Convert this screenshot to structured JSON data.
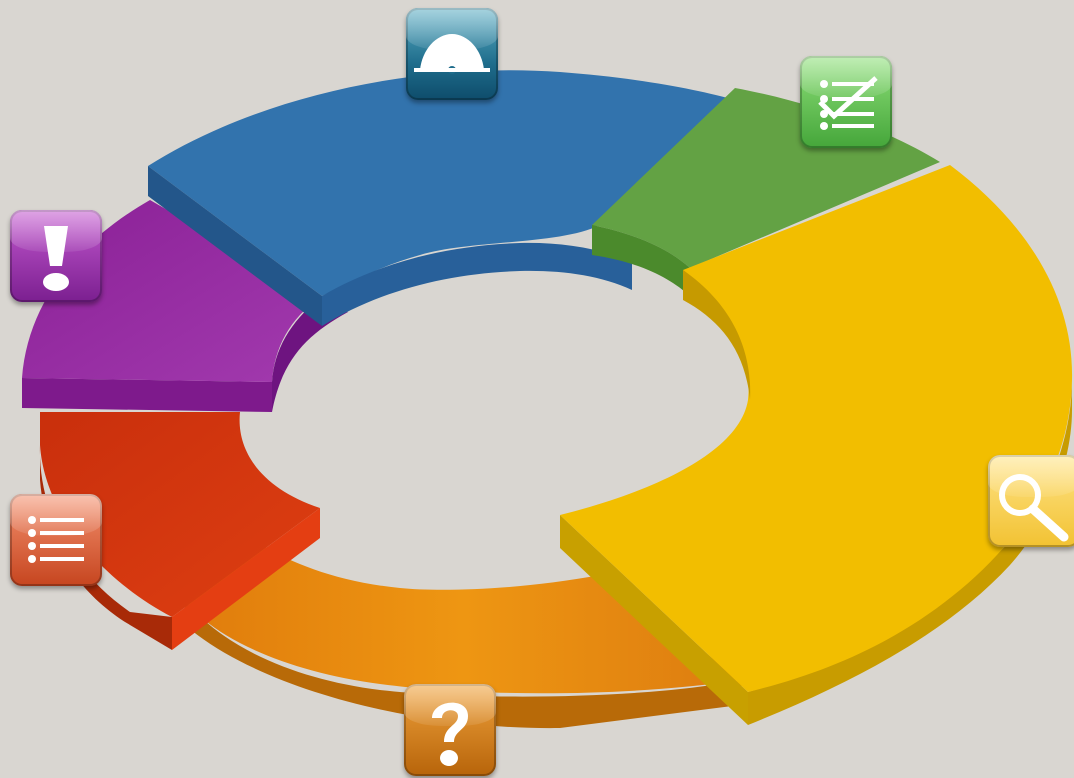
{
  "diagram": {
    "type": "segmented-ring",
    "segments": [
      {
        "name": "blue",
        "color": "#3274b0",
        "icon": "gear-icon"
      },
      {
        "name": "green",
        "color": "#63a244",
        "icon": "checklist-icon"
      },
      {
        "name": "yellow",
        "color": "#f2be00",
        "icon": "magnifier-icon"
      },
      {
        "name": "orange",
        "color": "#e68a10",
        "icon": "question-mark-icon"
      },
      {
        "name": "red",
        "color": "#d63a10",
        "icon": "list-icon"
      },
      {
        "name": "purple",
        "color": "#92279e",
        "icon": "exclamation-icon"
      }
    ],
    "background": "#d9d6d1"
  }
}
